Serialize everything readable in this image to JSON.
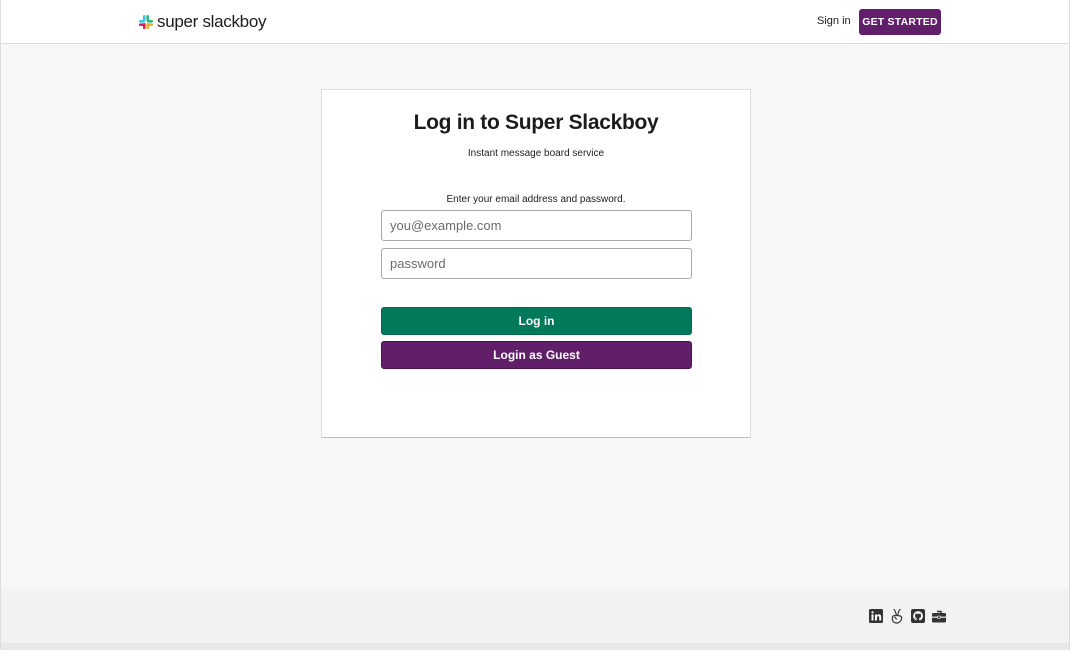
{
  "header": {
    "brand_name": "super slackboy",
    "signin_label": "Sign in",
    "get_started_label": "GET STARTED"
  },
  "login": {
    "title": "Log in to Super Slackboy",
    "subtitle": "Instant message board service",
    "instructions": "Enter your email address and password.",
    "email": {
      "value": "",
      "placeholder": "you@example.com"
    },
    "password": {
      "value": "",
      "placeholder": "password"
    },
    "login_button_label": "Log in",
    "guest_button_label": "Login as Guest"
  },
  "footer": {
    "social_icons": [
      "linkedin-icon",
      "angellist-icon",
      "github-icon",
      "portfolio-icon"
    ]
  },
  "colors": {
    "brand_purple": "#611f69",
    "login_green": "#007a5a",
    "page_background": "#f7f7f7"
  }
}
